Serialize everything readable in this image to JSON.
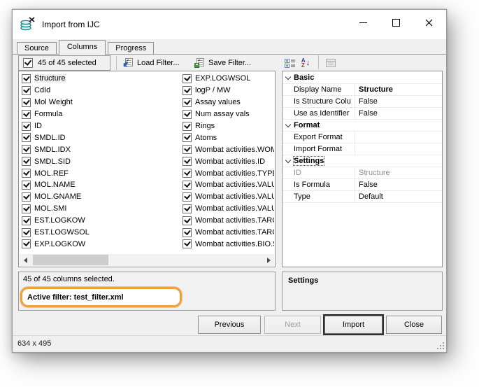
{
  "titlebar": {
    "title": "Import from IJC"
  },
  "tabs": [
    {
      "label": "Source",
      "active": false
    },
    {
      "label": "Columns",
      "active": true
    },
    {
      "label": "Progress",
      "active": false
    }
  ],
  "toolbar": {
    "selection_summary": "45 of 45 selected",
    "selection_checked": true,
    "load_filter_label": "Load Filter...",
    "save_filter_label": "Save Filter..."
  },
  "right_toolbar": {
    "icons": [
      "categorized-view-icon",
      "sort-alphabetically-icon",
      "property-editor-icon-disabled"
    ]
  },
  "column_list": {
    "selected_item": "Structure",
    "col1": [
      "Structure",
      "CdId",
      "Mol Weight",
      "Formula",
      "ID",
      "SMDL.ID",
      "SMDL.IDX",
      "SMDL.SID",
      "MOL.REF",
      "MOL.NAME",
      "MOL.GNAME",
      "MOL.SMI",
      "EST.LOGKOW",
      "EST.LOGWSOL",
      "EXP.LOGKOW"
    ],
    "col2": [
      "EXP.LOGWSOL",
      "logP / MW",
      "Assay values",
      "Num assay vals",
      "Rings",
      "Atoms",
      "Wombat activities.WOM",
      "Wombat activities.ID",
      "Wombat activities.TYPE",
      "Wombat activities.VALUI",
      "Wombat activities.VALUI",
      "Wombat activities.VALUI",
      "Wombat activities.TARG",
      "Wombat activities.TARG",
      "Wombat activities.BIO.S"
    ]
  },
  "properties": {
    "groups": [
      {
        "label": "Basic",
        "rows": [
          {
            "name": "Display Name",
            "value": "Structure"
          },
          {
            "name": "Is Structure Colu",
            "value": "False"
          },
          {
            "name": "Use as Identifier",
            "value": "False"
          }
        ]
      },
      {
        "label": "Format",
        "rows": [
          {
            "name": "Export Format",
            "value": ""
          },
          {
            "name": "Import Format",
            "value": ""
          }
        ]
      },
      {
        "label": "Settings",
        "rows": [
          {
            "name": "ID",
            "value": "Structure"
          },
          {
            "name": "Is Formula",
            "value": "False"
          },
          {
            "name": "Type",
            "value": "Default"
          }
        ]
      }
    ]
  },
  "summary": {
    "line1": "45 of 45 columns selected.",
    "active_filter": "Active filter: test_filter.xml"
  },
  "settings_panel": {
    "title": "Settings"
  },
  "buttons": [
    {
      "label": "Previous",
      "enabled": true
    },
    {
      "label": "Next",
      "enabled": false
    },
    {
      "label": "Import",
      "enabled": true,
      "focused": true
    },
    {
      "label": "Close",
      "enabled": true
    }
  ],
  "statusbar": {
    "size_text": "634 x 495"
  },
  "colors": {
    "annotation_orange": "#EDA03B",
    "window_bg": "#f0f0f0",
    "titlebar_bg": "#ffffff",
    "panel_bg": "#ffffff",
    "icon_teal": "#25808a",
    "icon_blue": "#2f62b5",
    "icon_green": "#3f9c3f"
  }
}
